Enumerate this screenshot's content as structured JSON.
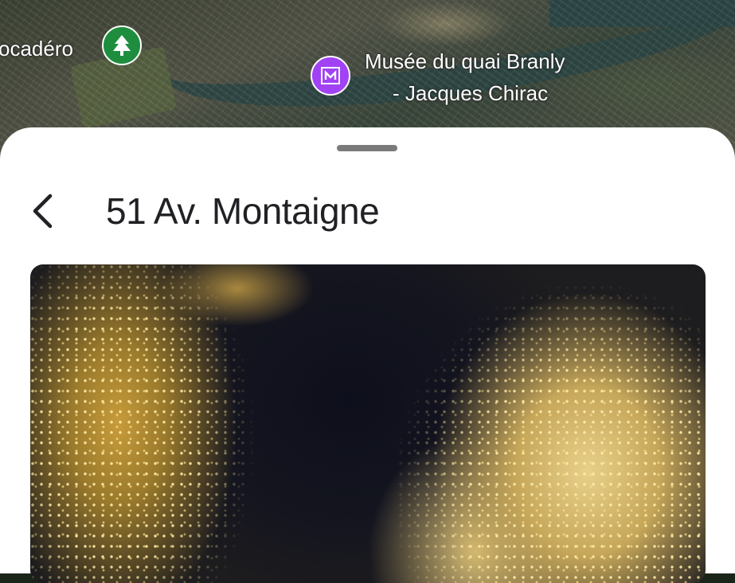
{
  "map": {
    "labels": {
      "trocadero": "ocadéro",
      "museum_line1": "Musée du quai Branly",
      "museum_line2": "- Jacques Chirac"
    },
    "pins": {
      "park": {
        "icon": "tree-icon",
        "color": "#1e8e3e"
      },
      "museum": {
        "icon": "museum-icon",
        "color": "#a142f4"
      }
    }
  },
  "sheet": {
    "title": "51 Av. Montaigne",
    "back_icon": "back-arrow-icon"
  },
  "photo": {
    "subject": "street-photo"
  }
}
